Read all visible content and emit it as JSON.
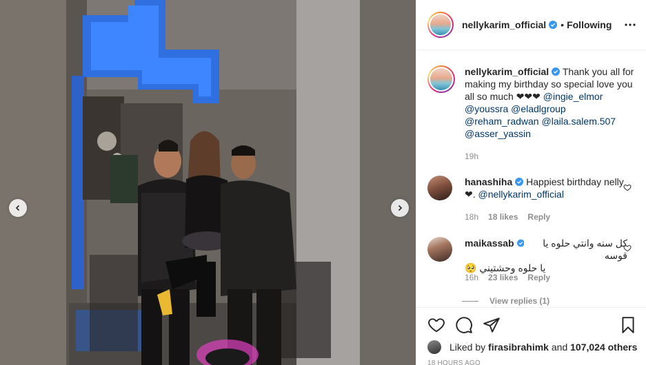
{
  "post": {
    "username": "nellykarim_official",
    "follow_status": "Following",
    "separator": "•"
  },
  "caption": {
    "username": "nellykarim_official",
    "text": "Thank you all for making my birthday so special love you all so much ❤❤❤",
    "mentions": [
      "@ingie_elmor",
      "@youssra",
      "@eladlgroup",
      "@reham_radwan",
      "@laila.salem.507",
      "@asser_yassin"
    ],
    "time": "19h"
  },
  "comments": [
    {
      "username": "hanashiha",
      "text": "Happiest birthday nelly ❤.",
      "mention": "@nellykarim_official",
      "time": "18h",
      "likes": "18 likes",
      "reply": "Reply"
    },
    {
      "username": "maikassab",
      "text_line1": "كل سنه وانتي حلوه يا قوسه",
      "text_line2": "يا حلوه وحشتيني 🥺",
      "time": "16h",
      "likes": "23 likes",
      "reply": "Reply"
    }
  ],
  "view_replies": "View replies (1)",
  "actions": {
    "icons": [
      "heart-icon",
      "comment-icon",
      "share-icon",
      "bookmark-icon"
    ]
  },
  "likes_line": {
    "prefix": "Liked by",
    "user": "firasibrahimk",
    "and": "and",
    "count": "107,024 others"
  },
  "timestamp": "18 HOURS AGO",
  "colors": {
    "mention": "#00376b",
    "muted": "#8e8e8e",
    "verified": "#3897f0"
  }
}
